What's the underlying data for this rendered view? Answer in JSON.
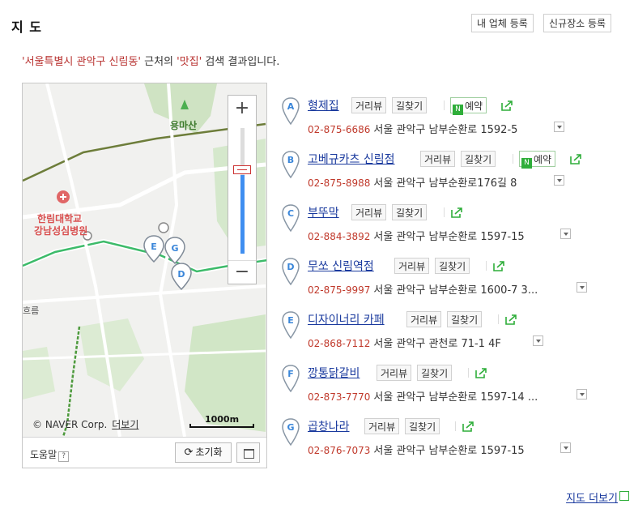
{
  "header": {
    "title": "지 도",
    "btn_my_business": "내 업체 등록",
    "btn_new_place": "신규장소 등록"
  },
  "notice": {
    "q1": "'서울특별시 관악구 신림동'",
    "mid": " 근처의 ",
    "q2": "'맛집'",
    "tail": " 검색 결과입니다."
  },
  "map": {
    "labels": {
      "mountain": "용마산",
      "hospital_line1": "한림대학교",
      "hospital_line2": "강남성심병원",
      "edge": "흐름"
    },
    "copyright": "© NAVER Corp.",
    "more_link": "더보기",
    "scale": "1000m",
    "help": "도움말",
    "help_q": "?",
    "reset": "초기화",
    "zoom_in": "+",
    "zoom_out": "−",
    "markers": [
      "E",
      "G",
      "D"
    ]
  },
  "results": [
    {
      "letter": "A",
      "name": "형제집",
      "review": "거리뷰",
      "route": "길찾기",
      "book": "예약",
      "phone": "02-875-6686",
      "addr": "서울 관악구 남부순환로 1592-5"
    },
    {
      "letter": "B",
      "name": "고베규카츠 신림점",
      "review": "거리뷰",
      "route": "길찾기",
      "book": "예약",
      "phone": "02-875-8988",
      "addr": "서울 관악구 남부순환로176길 8"
    },
    {
      "letter": "C",
      "name": "부뚜막",
      "review": "거리뷰",
      "route": "길찾기",
      "phone": "02-884-3892",
      "addr": "서울 관악구 남부순환로 1597-15"
    },
    {
      "letter": "D",
      "name": "무쏘 신림역점",
      "review": "거리뷰",
      "route": "길찾기",
      "phone": "02-875-9997",
      "addr": "서울 관악구 남부순환로 1600-7 3..."
    },
    {
      "letter": "E",
      "name": "디자이너리 카페",
      "review": "거리뷰",
      "route": "길찾기",
      "phone": "02-868-7112",
      "addr": "서울 관악구 관천로 71-1 4F"
    },
    {
      "letter": "F",
      "name": "깡통닭갈비",
      "review": "거리뷰",
      "route": "길찾기",
      "phone": "02-873-7770",
      "addr": "서울 관악구 남부순환로 1597-14 ..."
    },
    {
      "letter": "G",
      "name": "곱창나라",
      "review": "거리뷰",
      "route": "길찾기",
      "phone": "02-876-7073",
      "addr": "서울 관악구 남부순환로 1597-15"
    }
  ],
  "footer": {
    "more_map": "지도 더보기"
  },
  "colors": {
    "accent": "#1a3a9e",
    "phone": "#c0392b",
    "quote": "#b8312f",
    "pin": "#3a86d9",
    "book_green": "#2fae3a"
  }
}
